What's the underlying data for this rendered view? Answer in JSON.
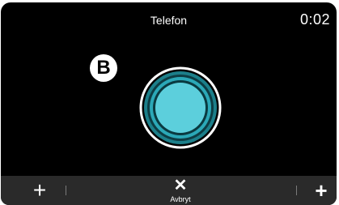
{
  "header": {
    "title": "Telefon",
    "timer": "0:02"
  },
  "marker": {
    "letter": "B"
  },
  "call_indicator": {
    "icon": "call-pulse-icon",
    "accent_color": "#5ccfdc"
  },
  "bottom_bar": {
    "left_button_icon": "plus-icon",
    "right_button_icon": "plus-icon",
    "cancel_icon": "close-icon",
    "cancel_label": "Avbryt"
  }
}
